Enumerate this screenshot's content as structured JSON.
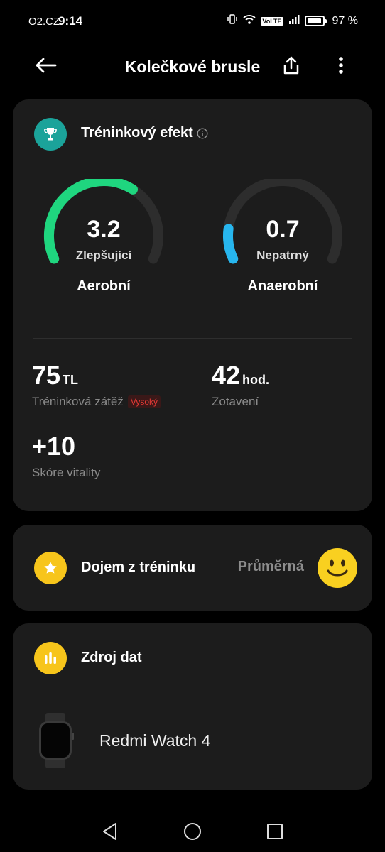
{
  "status_bar": {
    "carrier": "O2.CZ",
    "time": "9:14",
    "volte": "VoLTE",
    "battery": "97 %"
  },
  "header": {
    "title": "Kolečkové brusle"
  },
  "training_effect": {
    "title": "Tréninkový efekt",
    "aerobic": {
      "value": "3.2",
      "level": "Zlepšující",
      "label": "Aerobní",
      "fraction": 0.64,
      "color": "#1fd67f"
    },
    "anaerobic": {
      "value": "0.7",
      "level": "Nepatrný",
      "label": "Anaerobní",
      "fraction": 0.14,
      "color": "#27b6ee"
    },
    "training_load": {
      "value": "75",
      "unit": "TL",
      "label": "Tréninková zátěž",
      "badge": "Vysoký"
    },
    "recovery": {
      "value": "42",
      "unit": "hod.",
      "label": "Zotavení"
    },
    "vitality": {
      "value": "+10",
      "label": "Skóre vitality"
    }
  },
  "impression": {
    "title": "Dojem z tréninku",
    "value": "Průměrná"
  },
  "data_source": {
    "title": "Zdroj dat",
    "device": "Redmi Watch 4"
  },
  "colors": {
    "accent_teal": "#1ba39a",
    "accent_yellow": "#f7c51b",
    "track": "#2d2d2d"
  }
}
